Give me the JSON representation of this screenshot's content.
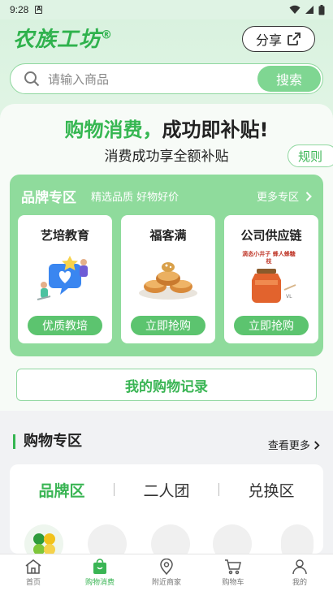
{
  "status": {
    "time": "9:28"
  },
  "header": {
    "brand": "农族工坊",
    "brand_mark": "®",
    "share_label": "分享"
  },
  "search": {
    "placeholder": "请输入商品",
    "button_label": "搜索"
  },
  "promo": {
    "headline_green": "购物消费，",
    "headline_dark": "成功即补贴!",
    "subline": "消费成功享全额补贴",
    "rule_label": "规则"
  },
  "brand_zone": {
    "title": "品牌专区",
    "subtitle": "精选品质 好物好价",
    "more_label": "更多专区",
    "products": [
      {
        "name": "艺培教育",
        "tag": "优质教培",
        "icon": "education-illustration-icon"
      },
      {
        "name": "福客满",
        "tag": "立即抢购",
        "icon": "pastry-plate-icon"
      },
      {
        "name": "公司供应链",
        "tag": "立即抢购",
        "icon": "honey-jar-icon",
        "image_text": "滴态小井子 蜂人蜂糖枝"
      }
    ]
  },
  "record_button": "我的购物记录",
  "shopping": {
    "title": "购物专区",
    "more_label": "查看更多",
    "tabs": [
      "品牌区",
      "二人团",
      "兑换区"
    ],
    "active_tab": 0
  },
  "bottom_nav": [
    {
      "label": "首页",
      "icon": "home-icon",
      "active": false
    },
    {
      "label": "购物消费",
      "icon": "shopping-bag-icon",
      "active": true
    },
    {
      "label": "附近商家",
      "icon": "location-pin-icon",
      "active": false
    },
    {
      "label": "购物车",
      "icon": "cart-icon",
      "active": false
    },
    {
      "label": "我的",
      "icon": "user-icon",
      "active": false
    }
  ],
  "colors": {
    "accent": "#3ab554",
    "zone": "#8fdb9c",
    "button": "#7fd692"
  }
}
